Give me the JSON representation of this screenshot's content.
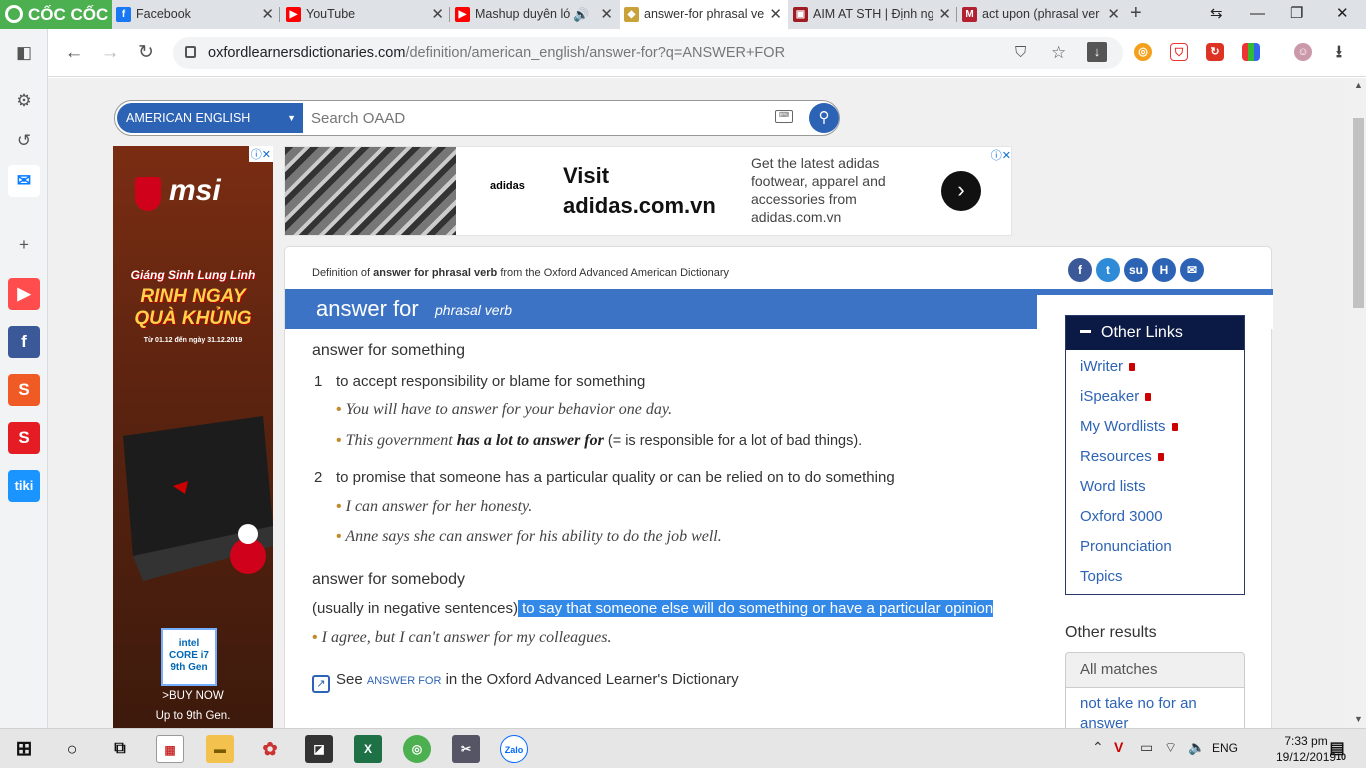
{
  "browser": {
    "logo_text": "CỐC CỐC",
    "tabs": [
      {
        "title": "Facebook",
        "favicon": "facebook-icon",
        "color": "#1877f2"
      },
      {
        "title": "YouTube",
        "favicon": "youtube-icon",
        "color": "#ff0000"
      },
      {
        "title": "Mashup duyên lớ",
        "favicon": "youtube-icon",
        "color": "#ff0000"
      },
      {
        "title": "answer-for phrasal ve",
        "favicon": "oxford-icon",
        "color": "#c9a23a"
      },
      {
        "title": "AIM AT STH | Định ng",
        "favicon": "cambridge-icon",
        "color": "#a01c22"
      },
      {
        "title": "act upon (phrasal ver",
        "favicon": "merriam-icon",
        "color": "#b3202f"
      }
    ],
    "url_domain": "oxfordlearnersdictionaries.com",
    "url_path": "/definition/american_english/answer-for?q=ANSWER+FOR"
  },
  "search": {
    "language": "AMERICAN ENGLISH",
    "placeholder": "Search OAAD"
  },
  "left_ad": {
    "brand": "msi",
    "promo_line1": "Giáng Sinh Lung Linh",
    "promo_line2": "RINH NGAY",
    "promo_line3": "QUÀ KHỦNG",
    "promo_line4": "Từ 01.12 đến ngày 31.12.2019",
    "intel_line1": "intel",
    "intel_line2": "CORE i7",
    "intel_line3": "9th Gen",
    "cta": ">BUY NOW",
    "cta2": "Up to 9th Gen."
  },
  "top_ad": {
    "logo": "adidas",
    "headline1": "Visit",
    "headline2": "adidas.com.vn",
    "description": "Get the latest adidas footwear, apparel and accessories from adidas.com.vn"
  },
  "entry": {
    "source_prefix": "Definition of ",
    "source_term": "answer for phrasal verb",
    "source_suffix": " from the Oxford Advanced American Dictionary",
    "headword": "answer for",
    "pos": "phrasal verb",
    "idm1": "answer for something",
    "sense1_num": "1",
    "sense1_def": "to accept responsibility or blame for something",
    "sense1_ex1": "You will have to answer for your behavior one day.",
    "sense1_ex2_pre": "This government ",
    "sense1_ex2_col": "has a lot to answer for",
    "sense1_ex2_gloss": " (= is responsible for a lot of bad things).",
    "sense2_num": "2",
    "sense2_def": "to promise that someone has a particular quality or can be relied on to do something",
    "sense2_ex1": "I can answer for her honesty.",
    "sense2_ex2": "Anne says she can answer for his ability to do the job well.",
    "idm2": "answer for somebody",
    "usage_label": "(usually in negative sentences)",
    "usage_def": " to say that someone else will do something or have a particular opinion",
    "sense3_ex1": "I agree, but I can't answer for my colleagues.",
    "see_prefix": "See ",
    "see_term": "answer for",
    "see_suffix": " in the Oxford Advanced Learner's Dictionary"
  },
  "other_links": {
    "title": "Other Links",
    "items": [
      "iWriter",
      "iSpeaker",
      "My Wordlists",
      "Resources",
      "Word lists",
      "Oxford 3000",
      "Pronunciation",
      "Topics"
    ]
  },
  "other_results": {
    "title": "Other results",
    "tab": "All matches",
    "first": "not take no for an answer"
  },
  "taskbar": {
    "lang": "ENG",
    "time": "7:33 pm",
    "date": "19/12/2019",
    "notifications": "10"
  }
}
